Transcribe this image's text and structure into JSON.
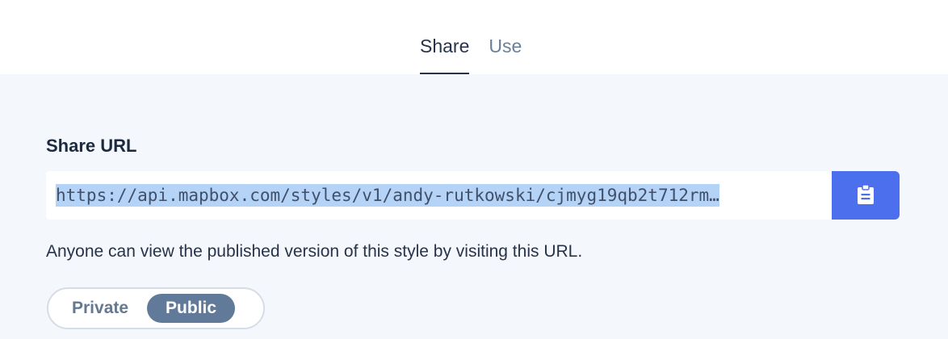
{
  "tabs": [
    {
      "label": "Share",
      "active": true
    },
    {
      "label": "Use",
      "active": false
    }
  ],
  "share": {
    "title": "Share URL",
    "url": "https://api.mapbox.com/styles/v1/andy-rutkowski/cjmyg19qb2t712rm…",
    "copy_icon": "clipboard-icon",
    "description": "Anyone can view the published version of this style by visiting this URL."
  },
  "visibility": {
    "options": [
      "Private",
      "Public"
    ],
    "selected": "Public"
  },
  "colors": {
    "accent": "#4c6fee",
    "toggle_active": "#627a99",
    "selection": "#b4d3f7"
  }
}
